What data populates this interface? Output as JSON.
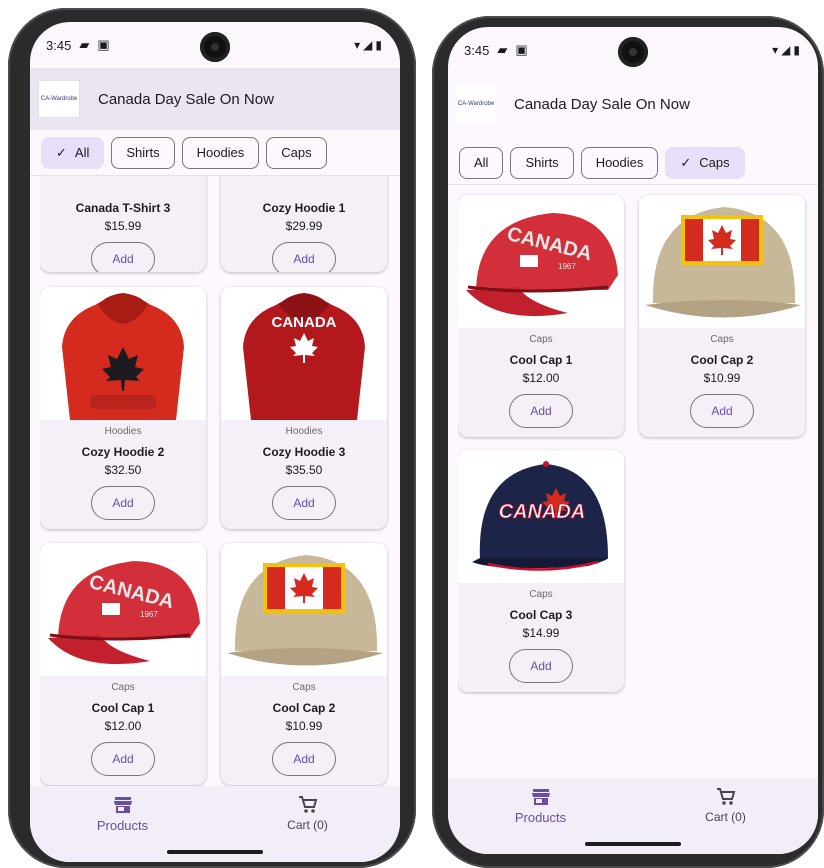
{
  "left": {
    "status": {
      "time": "3:45"
    },
    "appbar": {
      "logo_text": "CA-Wardrobe",
      "title": "Canada Day Sale On Now"
    },
    "chips": [
      {
        "label": "All",
        "selected": true
      },
      {
        "label": "Shirts",
        "selected": false
      },
      {
        "label": "Hoodies",
        "selected": false
      },
      {
        "label": "Caps",
        "selected": false
      }
    ],
    "products": [
      {
        "category": "",
        "name": "Canada T-Shirt 3",
        "price": "$15.99",
        "add": "Add"
      },
      {
        "category": "",
        "name": "Cozy Hoodie 1",
        "price": "$29.99",
        "add": "Add"
      },
      {
        "category": "Hoodies",
        "name": "Cozy Hoodie 2",
        "price": "$32.50",
        "add": "Add"
      },
      {
        "category": "Hoodies",
        "name": "Cozy Hoodie 3",
        "price": "$35.50",
        "add": "Add"
      },
      {
        "category": "Caps",
        "name": "Cool Cap 1",
        "price": "$12.00",
        "add": "Add"
      },
      {
        "category": "Caps",
        "name": "Cool Cap 2",
        "price": "$10.99",
        "add": "Add"
      }
    ],
    "nav": {
      "products": "Products",
      "cart": "Cart (0)"
    }
  },
  "right": {
    "status": {
      "time": "3:45"
    },
    "appbar": {
      "logo_text": "CA-Wardrobe",
      "title": "Canada Day Sale On Now"
    },
    "chips": [
      {
        "label": "All",
        "selected": false
      },
      {
        "label": "Shirts",
        "selected": false
      },
      {
        "label": "Hoodies",
        "selected": false
      },
      {
        "label": "Caps",
        "selected": true
      }
    ],
    "products": [
      {
        "category": "Caps",
        "name": "Cool Cap 1",
        "price": "$12.00",
        "add": "Add"
      },
      {
        "category": "Caps",
        "name": "Cool Cap 2",
        "price": "$10.99",
        "add": "Add"
      },
      {
        "category": "Caps",
        "name": "Cool Cap 3",
        "price": "$14.99",
        "add": "Add"
      }
    ],
    "nav": {
      "products": "Products",
      "cart": "Cart (0)"
    }
  },
  "colors": {
    "accent": "#6750a4",
    "chip_selected": "#e8def8",
    "background": "#fdf7fe",
    "canada_red": "#d52b1e"
  }
}
